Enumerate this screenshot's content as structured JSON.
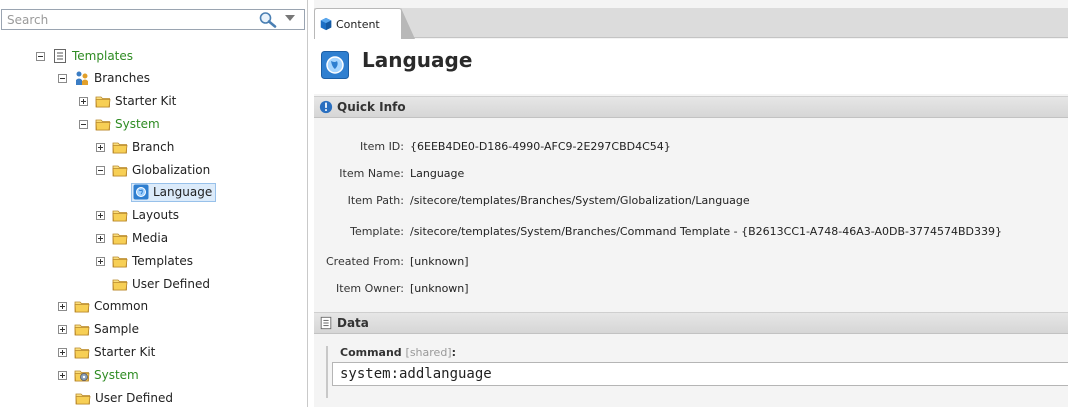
{
  "search": {
    "placeholder": "Search"
  },
  "tree": {
    "templates": "Templates",
    "branches": "Branches",
    "starter_kit": "Starter Kit",
    "system": "System",
    "branch": "Branch",
    "globalization": "Globalization",
    "language": "Language",
    "layouts": "Layouts",
    "media": "Media",
    "templates_sub": "Templates",
    "user_defined": "User Defined",
    "common": "Common",
    "sample": "Sample",
    "starter_kit_2": "Starter Kit",
    "system_2": "System",
    "user_defined_2": "User Defined"
  },
  "tab": {
    "label": "Content"
  },
  "header": {
    "title": "Language"
  },
  "quick_info": {
    "title": "Quick Info",
    "rows": [
      {
        "key": "Item ID:",
        "value": "{6EEB4DE0-D186-4990-AFC9-2E297CBD4C54}"
      },
      {
        "key": "Item Name:",
        "value": "Language"
      },
      {
        "key": "Item Path:",
        "value": "/sitecore/templates/Branches/System/Globalization/Language"
      },
      {
        "key": "Template:",
        "value": "/sitecore/templates/System/Branches/Command Template - {B2613CC1-A748-46A3-A0DB-3774574BD339}"
      },
      {
        "key": "Created From:",
        "value": "[unknown]"
      },
      {
        "key": "Item Owner:",
        "value": "[unknown]"
      }
    ]
  },
  "data_section": {
    "title": "Data",
    "field_label": "Command",
    "field_shared": "[shared]",
    "field_colon": ":",
    "field_value": "system:addlanguage"
  },
  "colors": {
    "green_label": "#2e8b22",
    "selection": "#dcebfa",
    "tab_blue": "#1d6fc4"
  }
}
